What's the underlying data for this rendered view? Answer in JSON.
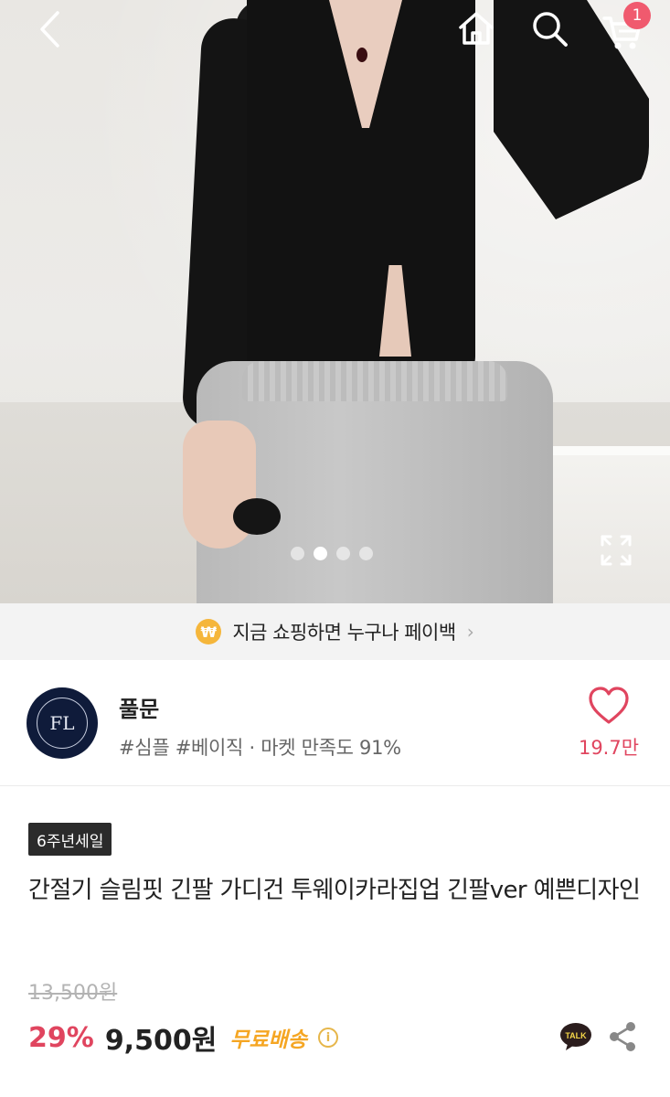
{
  "header": {
    "icons": {
      "back": "chevron-left-icon",
      "home": "home-icon",
      "search": "search-icon",
      "cart": "cart-icon"
    },
    "cart_badge": "1"
  },
  "hero": {
    "slide_count": 4,
    "active_slide": 2,
    "expand_icon": "expand-icon"
  },
  "banner": {
    "coin_symbol": "₩",
    "text": "지금 쇼핑하면 누구나 페이백",
    "chevron": "›"
  },
  "shop": {
    "logo_text": "FL",
    "name": "풀문",
    "tags": "#심플 #베이직 · 마켓 만족도 91%",
    "like_count": "19.7만"
  },
  "product": {
    "badge": "6주년세일",
    "title": "간절기 슬림핏 긴팔 가디건 투웨이카라집업 긴팔ver 예쁜디자인",
    "original_price": "13,500원",
    "discount": "29%",
    "price": "9,500원",
    "free_shipping": "무료배송",
    "info_symbol": "i",
    "talk_label": "TALK"
  },
  "colors": {
    "accent_pink": "#e0455f",
    "badge_pink": "#f05a6e",
    "free_ship_orange": "#f5a623",
    "coin_yellow": "#f5b63b"
  }
}
